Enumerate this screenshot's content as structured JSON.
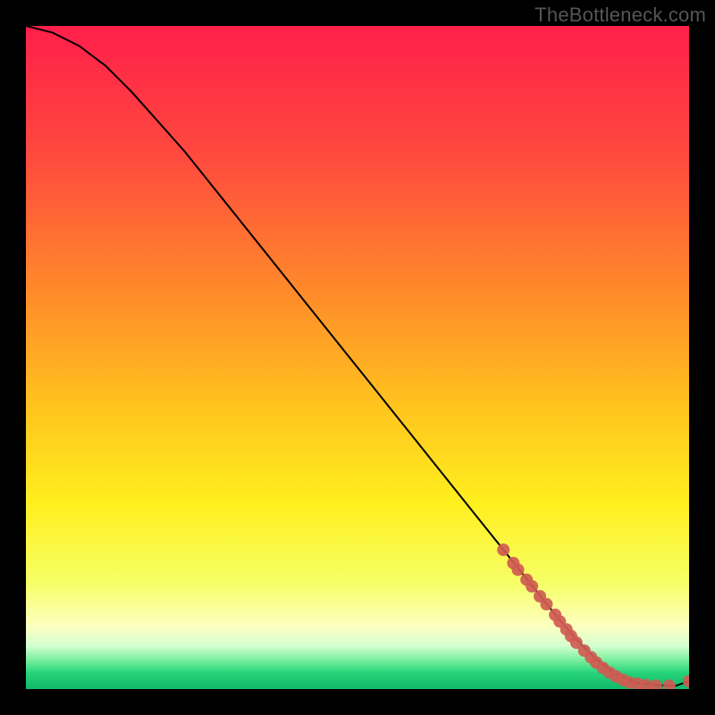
{
  "watermark": "TheBottleneck.com",
  "colors": {
    "frame_bg": "#000000",
    "curve": "#000000",
    "dot_fill": "#cf5b52",
    "dot_stroke": "#cf5b52"
  },
  "chart_data": {
    "type": "line",
    "title": "",
    "xlabel": "",
    "ylabel": "",
    "xlim": [
      0,
      100
    ],
    "ylim": [
      0,
      100
    ],
    "gradient_stops": [
      {
        "offset": 0.0,
        "color": "#ff1f4a"
      },
      {
        "offset": 0.2,
        "color": "#ff4b3e"
      },
      {
        "offset": 0.4,
        "color": "#ff8a2a"
      },
      {
        "offset": 0.58,
        "color": "#ffc61e"
      },
      {
        "offset": 0.72,
        "color": "#ffef1e"
      },
      {
        "offset": 0.84,
        "color": "#f6ff66"
      },
      {
        "offset": 0.905,
        "color": "#fdffc0"
      },
      {
        "offset": 0.935,
        "color": "#d3ffd0"
      },
      {
        "offset": 0.955,
        "color": "#7ff0a0"
      },
      {
        "offset": 0.975,
        "color": "#28d47a"
      },
      {
        "offset": 1.0,
        "color": "#0fb96a"
      }
    ],
    "series": [
      {
        "name": "bottleneck-curve",
        "x": [
          0,
          4,
          8,
          12,
          16,
          20,
          24,
          28,
          32,
          36,
          40,
          44,
          48,
          52,
          56,
          60,
          64,
          68,
          72,
          76,
          80,
          83,
          86,
          89,
          92,
          95,
          98,
          100
        ],
        "y": [
          100,
          99,
          97,
          94,
          90,
          85.5,
          81,
          76,
          71,
          66,
          61,
          56,
          51,
          46,
          41,
          36,
          31,
          26,
          21,
          16,
          11,
          7.5,
          4.5,
          2.2,
          1.0,
          0.6,
          0.5,
          1.2
        ]
      }
    ],
    "dots": {
      "name": "highlighted-points",
      "x": [
        72,
        73.5,
        74.2,
        75.5,
        76.3,
        77.5,
        78.5,
        79.8,
        80.5,
        81.5,
        82.2,
        83.0,
        84.2,
        85.2,
        86.0,
        87.0,
        88.0,
        89.0,
        90.0,
        91.0,
        92.2,
        93.5,
        95.0,
        97.0,
        100.0
      ],
      "y": [
        21.0,
        19.0,
        18.0,
        16.5,
        15.5,
        14.0,
        12.8,
        11.2,
        10.2,
        9.0,
        8.0,
        7.0,
        5.8,
        4.8,
        4.0,
        3.2,
        2.5,
        1.9,
        1.4,
        1.0,
        0.8,
        0.6,
        0.5,
        0.5,
        1.2
      ]
    }
  }
}
